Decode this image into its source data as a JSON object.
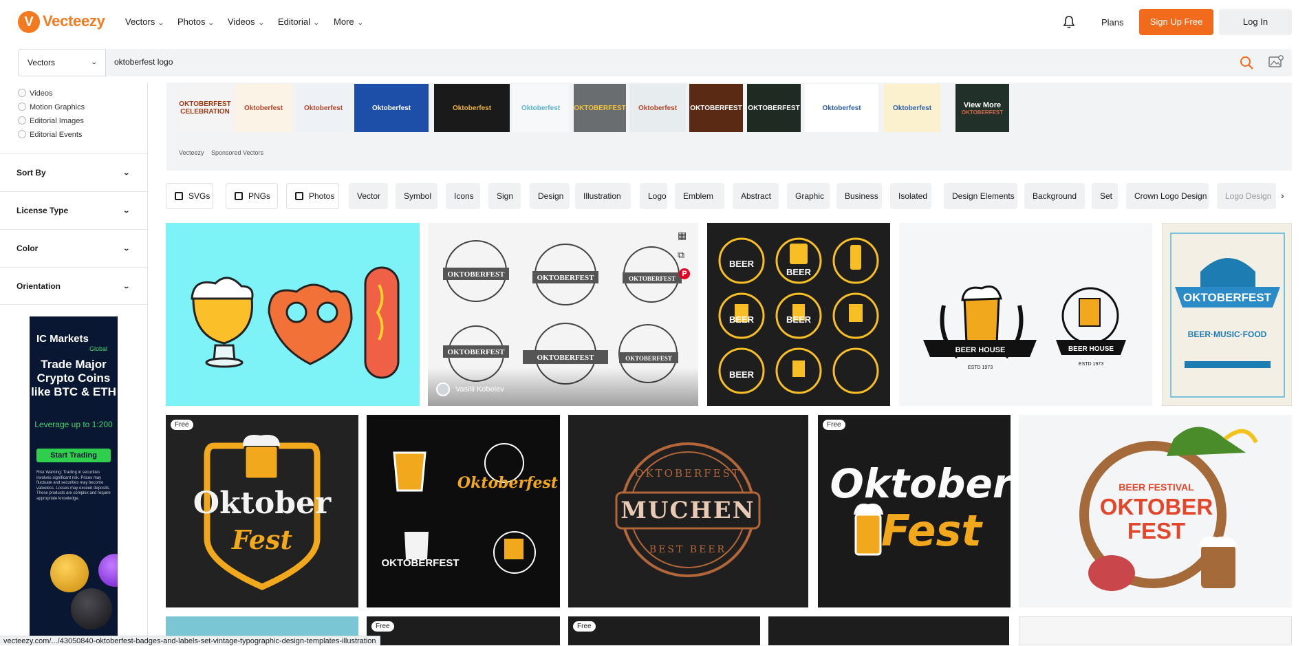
{
  "header": {
    "logo_text": "Vecteezy",
    "logo_glyph": "V",
    "nav": [
      "Vectors",
      "Photos",
      "Videos",
      "Editorial",
      "More"
    ],
    "plans": "Plans",
    "signup": "Sign Up Free",
    "login": "Log In"
  },
  "search": {
    "type": "Vectors",
    "query": "oktoberfest logo"
  },
  "sidebar": {
    "content_types": [
      "Videos",
      "Motion Graphics",
      "Editorial Images",
      "Editorial Events"
    ],
    "filters": [
      "Sort By",
      "License Type",
      "Color",
      "Orientation"
    ]
  },
  "ad": {
    "brand": "IC Markets",
    "brand_sub": "Global",
    "headline": "Trade Major Crypto Coins like BTC & ETH",
    "leverage": "Leverage up to 1:200",
    "cta": "Start Trading",
    "risk": "Risk Warning: Trading in securities involves significant risk. Prices may fluctuate and securities may become valueless. Losses may exceed deposits. These products are complex and require appropriate knowledge."
  },
  "sponsored": {
    "thumbs": [
      {
        "text": "OKTOBERFEST CELEBRATION",
        "bg": "#f4f4f4",
        "fg": "#9a3a14"
      },
      {
        "text": "Oktoberfest",
        "bg": "#fbf3e6",
        "fg": "#b3462a"
      },
      {
        "text": "Oktoberfest",
        "bg": "#eef2f6",
        "fg": "#b3462a"
      },
      {
        "text": "Oktoberfest",
        "bg": "#1e4fa8",
        "fg": "#ffffff"
      },
      {
        "text": "Oktoberfest",
        "bg": "#1a1a1a",
        "fg": "#e9b23a"
      },
      {
        "text": "Oktoberfest",
        "bg": "#f6f8f9",
        "fg": "#5ab2cf"
      },
      {
        "text": "OKTOBERFEST",
        "bg": "#6a6d70",
        "fg": "#f3c23b"
      },
      {
        "text": "Oktoberfest",
        "bg": "#e7ecef",
        "fg": "#b3462a"
      },
      {
        "text": "OKTOBERFEST",
        "bg": "#5a2a14",
        "fg": "#ffffff"
      },
      {
        "text": "OKTOBERFEST",
        "bg": "#1f2a22",
        "fg": "#ffffff"
      },
      {
        "text": "Oktoberfest",
        "bg": "#ffffff",
        "fg": "#2c5fa6"
      },
      {
        "text": "Oktoberfest",
        "bg": "#fbf1cf",
        "fg": "#2c5fa6"
      }
    ],
    "view_more": "View More",
    "view_more_sub": "OKTOBERFEST",
    "label_brand": "Vecteezy",
    "label_text": "Sponsored Vectors"
  },
  "chips": {
    "format_chips": [
      "SVGs",
      "PNGs",
      "Photos"
    ],
    "tag_chips": [
      "Vector",
      "Symbol",
      "Icons",
      "Sign",
      "Design",
      "Illustration",
      "Logo",
      "Emblem",
      "Abstract",
      "Graphic",
      "Business",
      "Isolated",
      "Design Elements",
      "Background",
      "Set",
      "Crown Logo Design",
      "Logo Design"
    ]
  },
  "gallery": {
    "row1": [
      {
        "title": "beer pretzel sausage",
        "bg": "#7df3f7"
      },
      {
        "title": "Oktoberfest badges and labels set",
        "author": "Vasilii Kobelev",
        "bg": "#f4f4f4"
      },
      {
        "title": "BEER",
        "bg": "#1e1e1e"
      },
      {
        "title": "BEER HOUSE",
        "est": "ESTD 1973",
        "bg": "#f5f6f7"
      },
      {
        "title": "OKTOBERFEST",
        "sub": "BEER·MUSIC·FOOD",
        "bg": "#f3efe4"
      }
    ],
    "row2": [
      {
        "line1": "Oktober",
        "line2": "Fest",
        "badge": "Free",
        "bg": "#222"
      },
      {
        "line1": "Oktoberfest",
        "line2": "OKTOBERFEST",
        "bg": "#0d0d0d"
      },
      {
        "line1": "OKTOBERFEST",
        "line2": "MUCHEN",
        "line3": "BEST BEER",
        "bg": "#1f1f1f"
      },
      {
        "line1": "Oktober",
        "line2": "Fest",
        "badge": "Free",
        "bg": "#1a1a1a"
      },
      {
        "line1": "BEER FESTIVAL",
        "line2": "OKTOBER",
        "line3": "FEST",
        "bg": "#f4f5f6"
      }
    ],
    "row3_badges": [
      "Free",
      "Free"
    ]
  },
  "status_url": "vecteezy.com/.../43050840-oktoberfest-badges-and-labels-set-vintage-typographic-design-templates-illustration"
}
